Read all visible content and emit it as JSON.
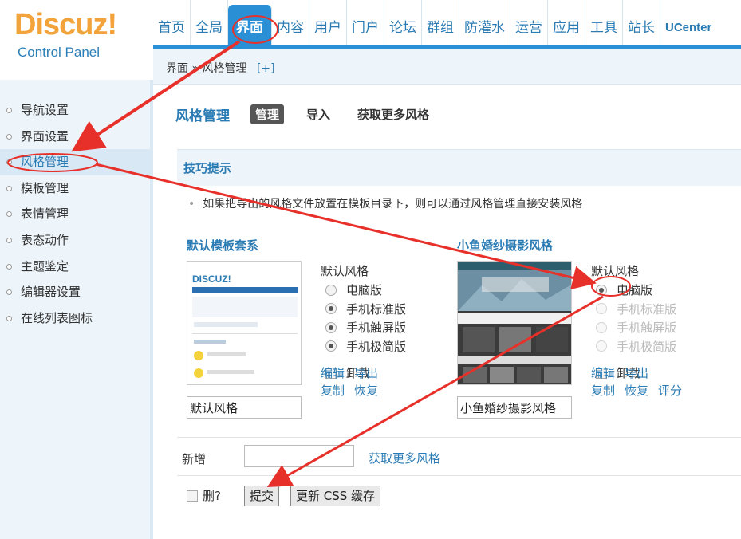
{
  "logo": {
    "brand": "Discuz!",
    "subtitle": "Control Panel"
  },
  "topnav": {
    "items": [
      "首页",
      "全局",
      "界面",
      "内容",
      "用户",
      "门户",
      "论坛",
      "群组",
      "防灌水",
      "运营",
      "应用",
      "工具",
      "站长",
      "UCenter"
    ],
    "active_index": 2
  },
  "breadcrumb": {
    "section": "界面",
    "separator": "»",
    "page": "风格管理",
    "add": "[+]"
  },
  "sidebar": {
    "items": [
      "导航设置",
      "界面设置",
      "风格管理",
      "模板管理",
      "表情管理",
      "表态动作",
      "主题鉴定",
      "编辑器设置",
      "在线列表图标"
    ],
    "active_index": 2
  },
  "main": {
    "title": "风格管理",
    "tabs": [
      "管理",
      "导入",
      "获取更多风格"
    ],
    "active_tab": 0,
    "tips_title": "技巧提示",
    "tip": "如果把导出的风格文件放置在模板目录下，则可以通过风格管理直接安装风格",
    "styles": [
      {
        "name": "默认模板套系",
        "input_value": "默认风格",
        "options_label": "默认风格",
        "options": [
          {
            "label": "电脑版",
            "checked": false,
            "disabled": false
          },
          {
            "label": "手机标准版",
            "checked": true,
            "disabled": false
          },
          {
            "label": "手机触屏版",
            "checked": true,
            "disabled": false
          },
          {
            "label": "手机极简版",
            "checked": true,
            "disabled": false
          }
        ],
        "uninstall": "卸载",
        "links": [
          "编辑",
          "导出",
          "复制",
          "恢复"
        ]
      },
      {
        "name": "小鱼婚纱摄影风格",
        "input_value": "小鱼婚纱摄影风格",
        "options_label": "默认风格",
        "options": [
          {
            "label": "电脑版",
            "checked": true,
            "disabled": false
          },
          {
            "label": "手机标准版",
            "checked": false,
            "disabled": true
          },
          {
            "label": "手机触屏版",
            "checked": false,
            "disabled": true
          },
          {
            "label": "手机极简版",
            "checked": false,
            "disabled": true
          }
        ],
        "uninstall": "卸载",
        "links": [
          "编辑",
          "导出",
          "复制",
          "恢复",
          "评分"
        ]
      }
    ],
    "new_label": "新增",
    "new_link": "获取更多风格",
    "delete_label": "删?",
    "submit_label": "提交",
    "update_css_label": "更新 CSS 缓存"
  },
  "colors": {
    "accent": "#2b8fd6",
    "link": "#2a7bb4",
    "logo_orange": "#f3a33b",
    "annotation_red": "#e8302a"
  }
}
